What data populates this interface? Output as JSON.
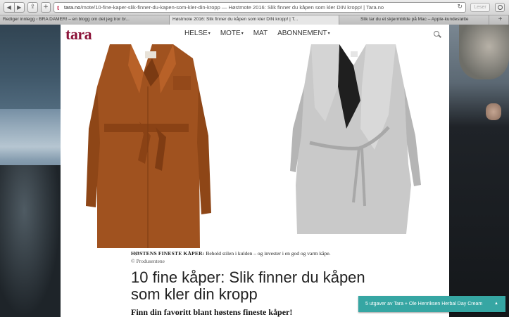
{
  "browser": {
    "nav_back": "◀",
    "nav_forward": "▶",
    "share_icon": "⇪",
    "new_tab": "+",
    "address_domain": "tara.no",
    "address_rest": "/mote/10-fine-kaper-slik-finner-du-kapen-som-kler-din-kropp — Høstmote 2016: Slik finner du kåpen som kler DIN kropp! | Tara.no",
    "reload_icon": "↻",
    "reader_label": "Leser",
    "tabs": [
      {
        "label": "Rediger innlegg ‹ BRA DAMER! – en blogg om det jeg tror br..."
      },
      {
        "label": "Høstmote 2016: Slik finner du kåpen som kler DIN kropp! | T..."
      },
      {
        "label": "Slik tar du et skjermbilde på Mac – Apple-kundestøtte"
      }
    ],
    "tab_add": "+"
  },
  "site": {
    "logo": "tara",
    "nav": [
      {
        "label": "HELSE",
        "caret": "▾"
      },
      {
        "label": "MOTE",
        "caret": "▾"
      },
      {
        "label": "MAT",
        "caret": ""
      },
      {
        "label": "ABONNEMENT",
        "caret": "▾"
      }
    ],
    "search_icon": "search-icon"
  },
  "article": {
    "caption_title": "HØSTENS FINESTE KÅPER:",
    "caption_text": "Behold stilen i kulden – og invester i en god og varm kåpe.",
    "credit": "© Produsentene",
    "headline": "10 fine kåper: Slik finner du kåpen som kler din kropp",
    "subhead": "Finn din favoritt blant høstens fineste kåper!"
  },
  "promo": {
    "label": "5 utgaver av Tara + Ole Henriksen Herbal Day Cream",
    "arrow": "▲"
  },
  "colors": {
    "brand": "#8c1339",
    "promo": "#36a6a3",
    "coat_left": "#a0521f",
    "coat_right": "#c9c9c9"
  }
}
